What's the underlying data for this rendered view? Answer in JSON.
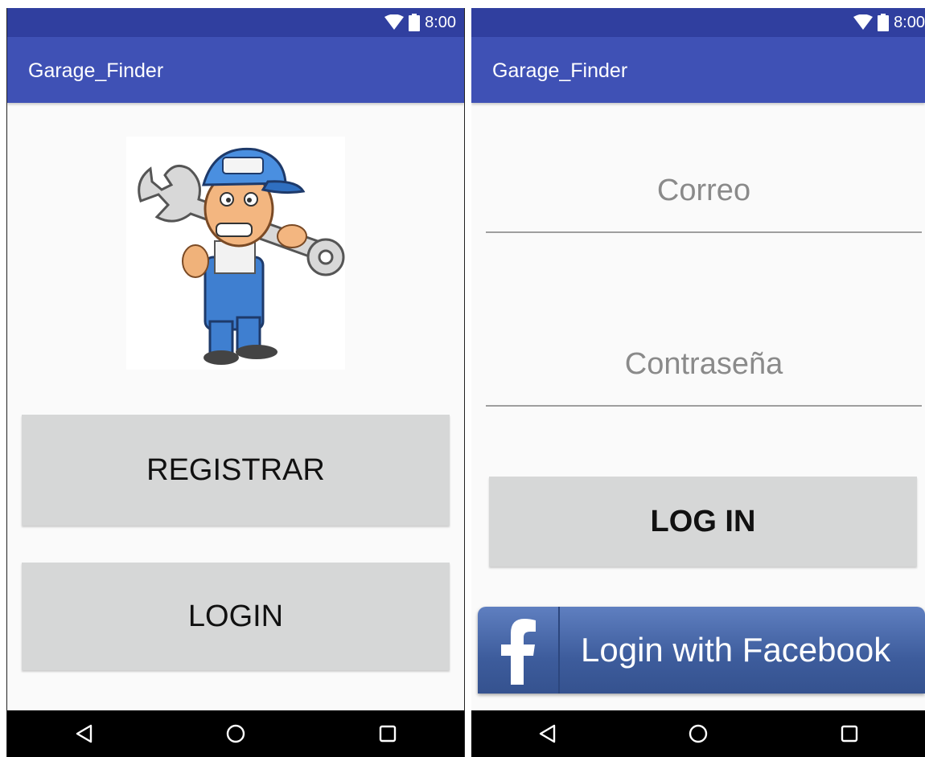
{
  "left_screen": {
    "status": {
      "time": "8:00"
    },
    "app_title": "Garage_Finder",
    "buttons": {
      "register": "REGISTRAR",
      "login": "LOGIN"
    }
  },
  "right_screen": {
    "status": {
      "time": "8:00"
    },
    "app_title": "Garage_Finder",
    "email_field": {
      "placeholder": "Correo",
      "value": ""
    },
    "password_field": {
      "placeholder": "Contraseña",
      "value": ""
    },
    "login_button": "LOG IN",
    "facebook_button": "Login with Facebook"
  },
  "colors": {
    "status_bar": "#303f9f",
    "app_bar": "#3f51b5",
    "button_bg": "#d6d7d7",
    "facebook_blue": "#3b5998"
  },
  "icons": [
    "wifi-icon",
    "battery-icon",
    "back-icon",
    "home-icon",
    "recents-icon",
    "facebook-f-icon",
    "mechanic-illustration"
  ]
}
